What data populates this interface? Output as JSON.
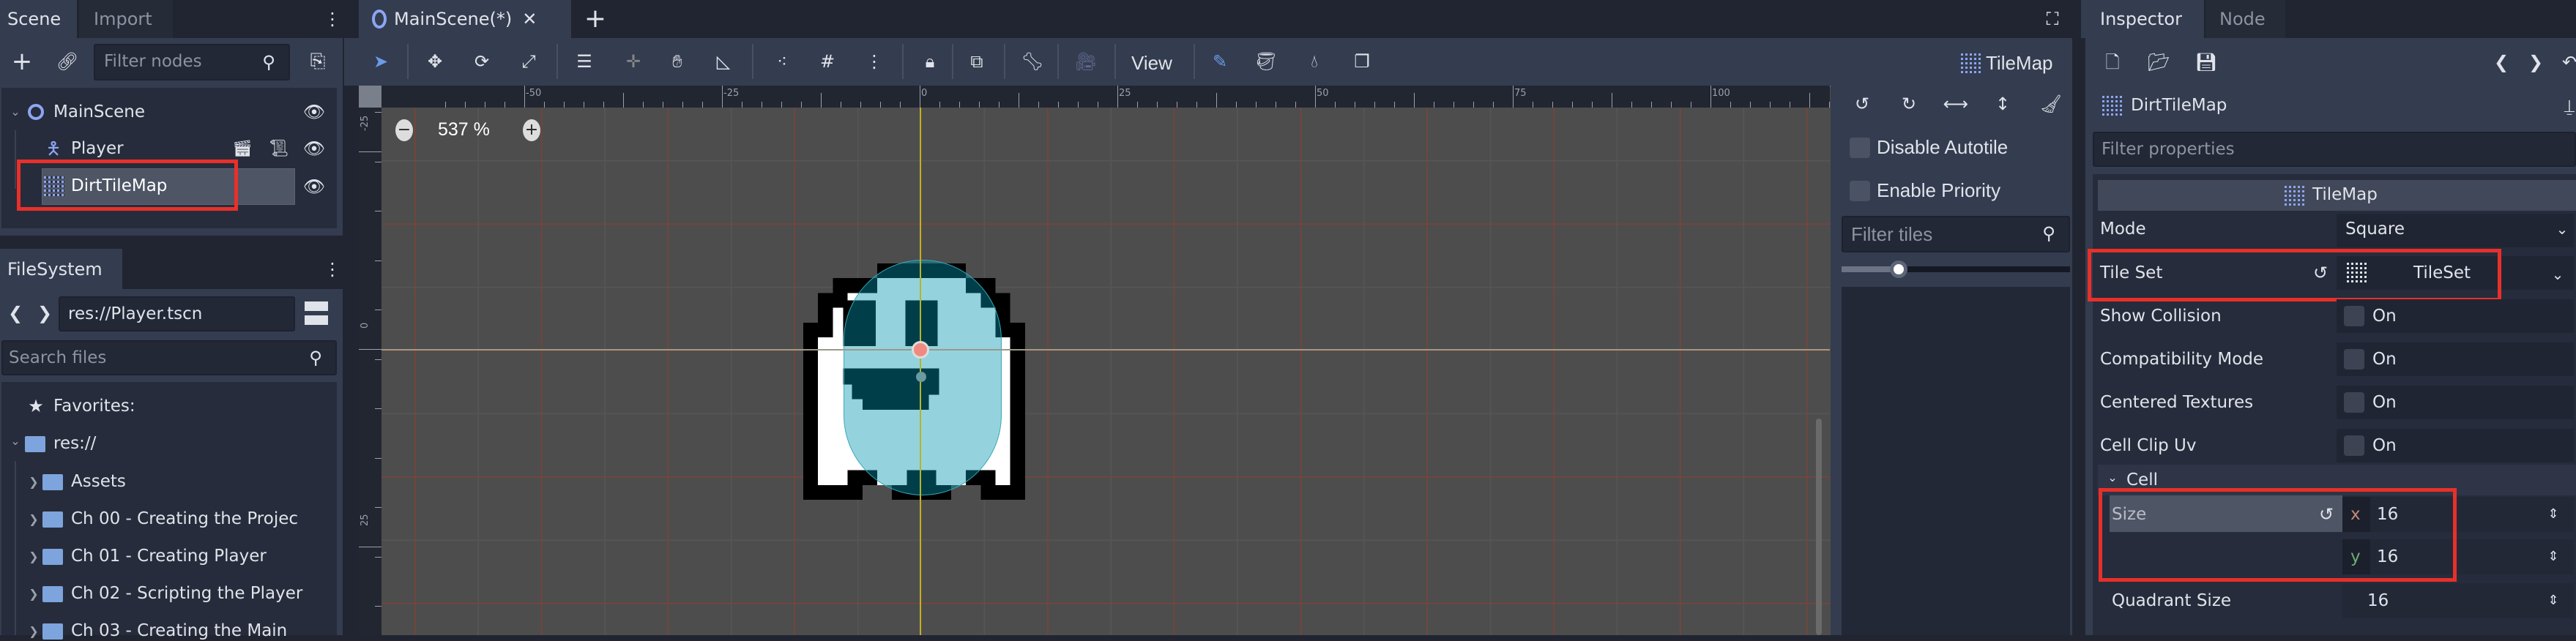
{
  "scene_dock": {
    "tabs": [
      "Scene",
      "Import"
    ],
    "filter_placeholder": "Filter nodes",
    "tree": [
      {
        "label": "MainScene",
        "icon": "node2d-circle-icon"
      },
      {
        "label": "Player",
        "icon": "kinematic-body-icon"
      },
      {
        "label": "DirtTileMap",
        "icon": "tilemap-icon",
        "selected": true
      }
    ]
  },
  "filesystem_dock": {
    "tab": "FileSystem",
    "path": "res://Player.tscn",
    "search_placeholder": "Search files",
    "favorites": "Favorites:",
    "root": "res://",
    "folders": [
      "Assets",
      "Ch 00 - Creating the Projec",
      "Ch 01 - Creating Player",
      "Ch 02 - Scripting the Player",
      "Ch 03 - Creating the Main"
    ]
  },
  "editor": {
    "scene_tab": "MainScene(*)",
    "view_menu": "View",
    "zoom_level": "537 %",
    "ruler_x": [
      "-50",
      "-25",
      "0",
      "25",
      "50",
      "75",
      "100"
    ],
    "ruler_y": [
      "-25",
      "0",
      "25"
    ]
  },
  "tilemap_panel": {
    "title": "TileMap",
    "disable_autotile": "Disable Autotile",
    "enable_priority": "Enable Priority",
    "filter_placeholder": "Filter tiles",
    "slider_value": 0.25
  },
  "inspector": {
    "tabs": [
      "Inspector",
      "Node"
    ],
    "node_name": "DirtTileMap",
    "filter_placeholder": "Filter properties",
    "section": "TileMap",
    "mode_label": "Mode",
    "mode_value": "Square",
    "tileset_label": "Tile Set",
    "tileset_value": "TileSet",
    "show_collision": "Show Collision",
    "compat_mode": "Compatibility Mode",
    "centered_textures": "Centered Textures",
    "cell_clip_uv": "Cell Clip Uv",
    "on": "On",
    "cell_group": "Cell",
    "size_label": "Size",
    "x_label": "x",
    "size_x": "16",
    "y_label": "y",
    "size_y": "16",
    "quadrant_label": "Quadrant Size",
    "quadrant_value": "16"
  },
  "colors": {
    "accent": "#699ce8",
    "highlight": "#e8302a",
    "viewport": "#4d4d4d"
  }
}
